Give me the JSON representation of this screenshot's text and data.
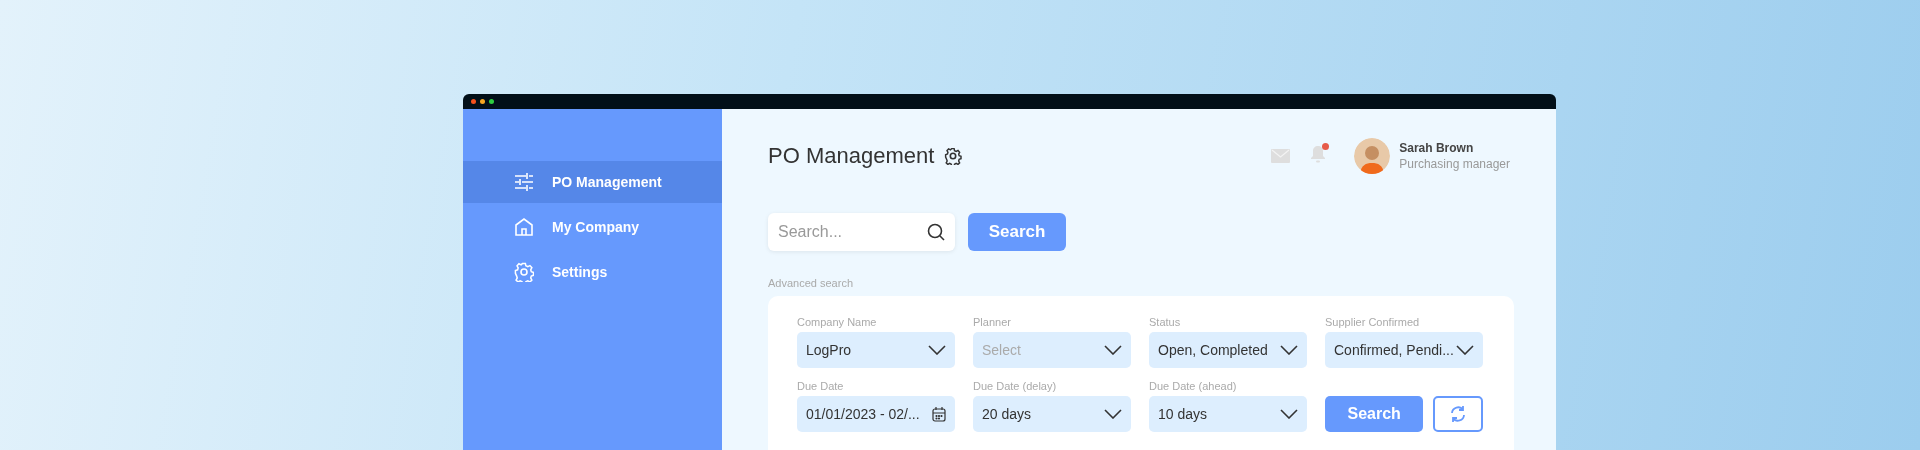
{
  "sidebar": {
    "items": [
      {
        "label": "PO Management",
        "kind": "sliders",
        "selected": true
      },
      {
        "label": "My Company",
        "kind": "home",
        "selected": false
      },
      {
        "label": "Settings",
        "kind": "gear",
        "selected": false
      }
    ]
  },
  "header": {
    "title": "PO Management",
    "notification_unread": true,
    "user": {
      "name": "Sarah Brown",
      "role": "Purchasing manager"
    }
  },
  "search": {
    "placeholder": "Search...",
    "button": "Search"
  },
  "advanced_search": {
    "label": "Advanced search",
    "fields": [
      {
        "kind": "select",
        "label": "Company Name",
        "value": "LogPro"
      },
      {
        "kind": "select",
        "label": "Planner",
        "placeholder": "Select"
      },
      {
        "kind": "select",
        "label": "Status",
        "value": "Open, Completed"
      },
      {
        "kind": "select",
        "label": "Supplier Confirmed",
        "value": "Confirmed, Pendi..."
      },
      {
        "kind": "date",
        "label": "Due Date",
        "value": "01/01/2023 - 02/..."
      },
      {
        "kind": "select",
        "label": "Due Date (delay)",
        "value": "20 days"
      },
      {
        "kind": "select",
        "label": "Due Date (ahead)",
        "value": "10 days"
      }
    ],
    "button": "Search"
  }
}
